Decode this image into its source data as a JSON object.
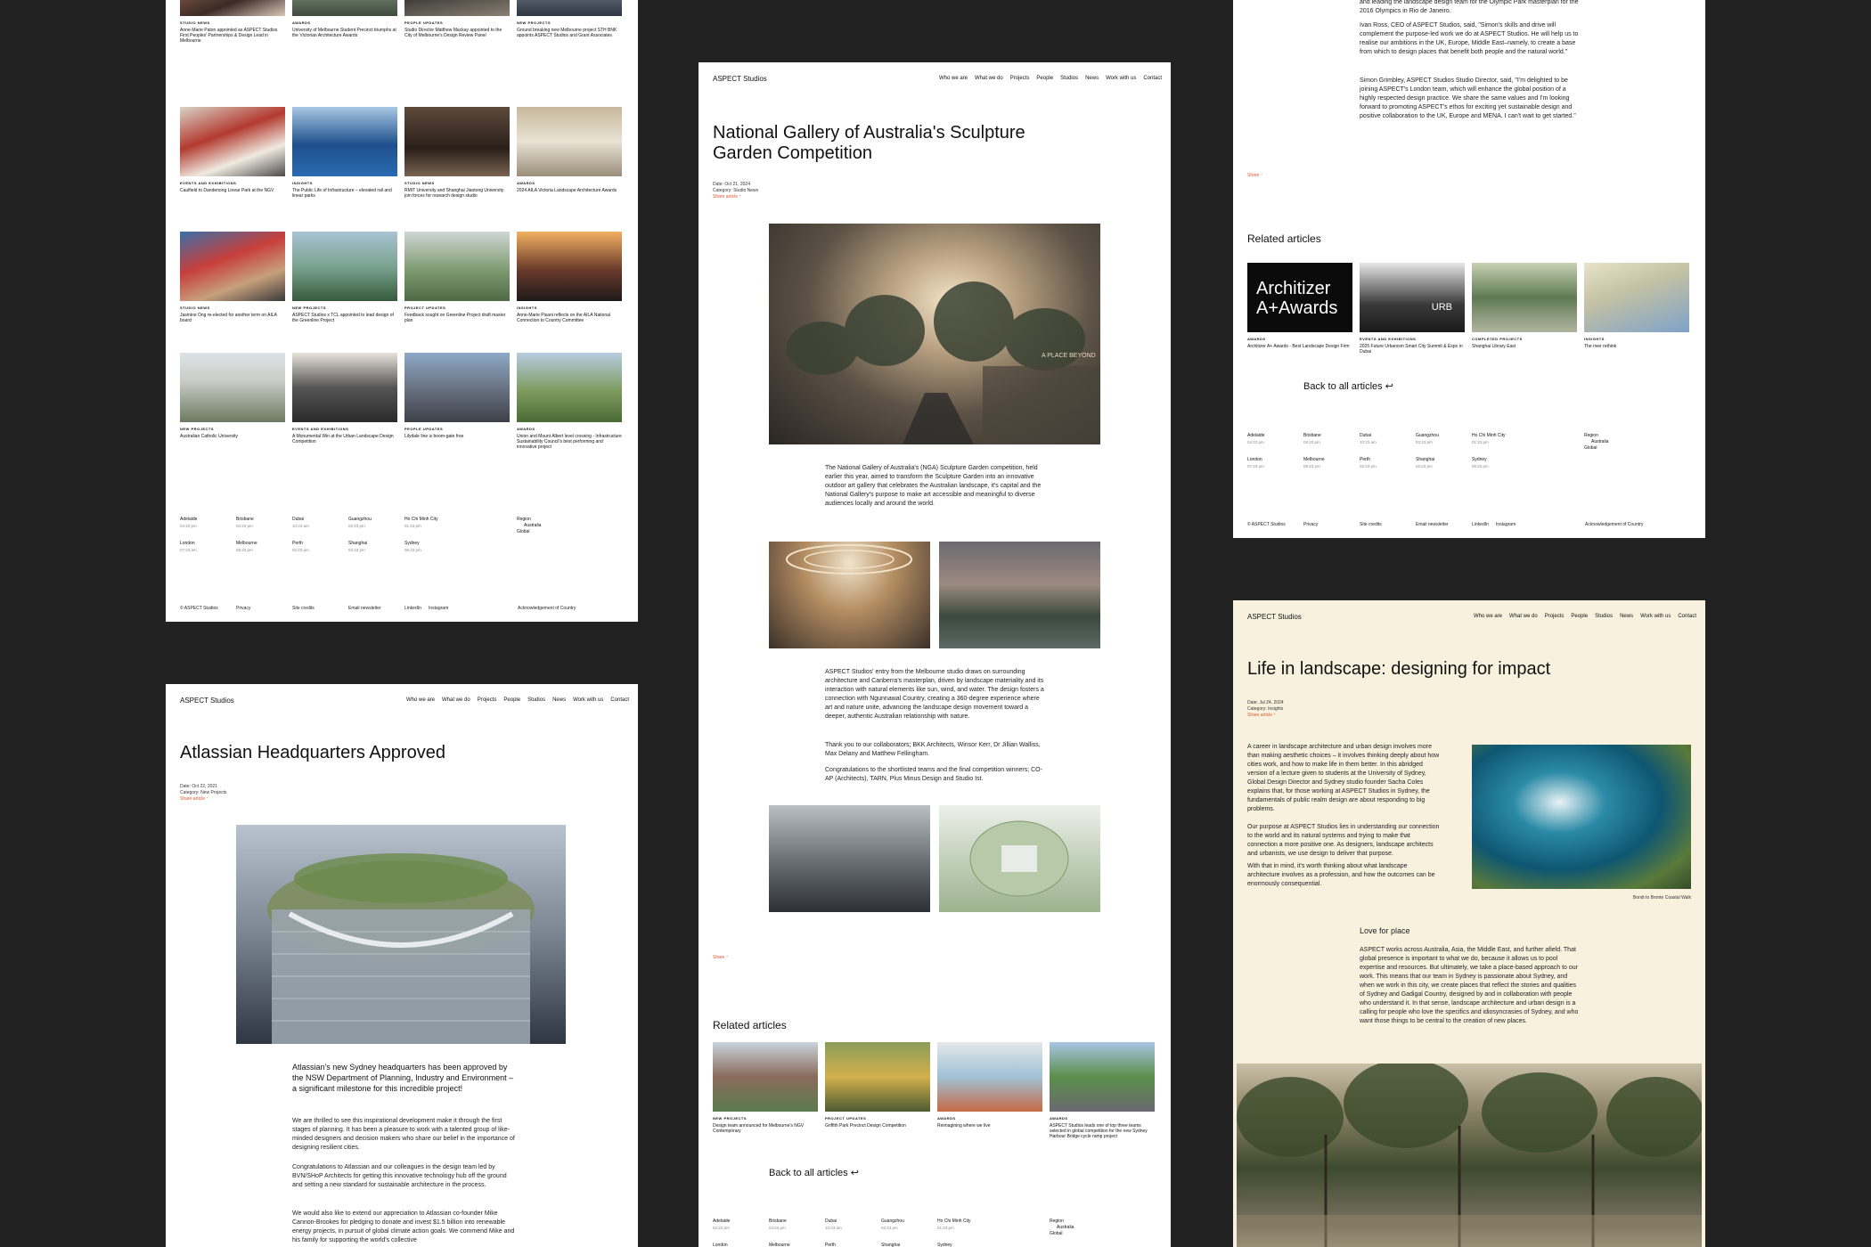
{
  "site": {
    "logo": "ASPECT Studios",
    "nav": [
      "Who we are",
      "What we do",
      "Projects",
      "People",
      "Studios",
      "News",
      "Work with us",
      "Contact"
    ]
  },
  "grid_panel": {
    "tiles": [
      {
        "cat": "Studio News",
        "title": "Anne-Marie Paton appointed as ASPECT Studios First Peoples' Partnerships & Design Lead in Melbourne"
      },
      {
        "cat": "Awards",
        "title": "University of Melbourne Student Precinct triumphs at the Victorian Architecture Awards"
      },
      {
        "cat": "People Updates",
        "title": "Studio Director Matthew Mackay appointed to the City of Melbourne's Design Review Panel"
      },
      {
        "cat": "New Projects",
        "title": "Ground breaking new Melbourne project STH BNK appoints ASPECT Studios and Grant Associates"
      },
      {
        "cat": "Events and Exhibitions",
        "title": "Caulfield to Dandenong Linear Park at the NGV"
      },
      {
        "cat": "Insights",
        "title": "The Public Life of Infrastructure – elevated rail and linear parks"
      },
      {
        "cat": "Studio News",
        "title": "RMIT University and Shanghai Jiaotong University join forces for research design studio"
      },
      {
        "cat": "Awards",
        "title": "2024 AILA Victoria Landscape Architecture Awards"
      },
      {
        "cat": "Studio News",
        "title": "Jasmine Ong re-elected for another term on AILA board"
      },
      {
        "cat": "New Projects",
        "title": "ASPECT Studios x TCL appointed to lead design of the Greenline Project"
      },
      {
        "cat": "Project Updates",
        "title": "Feedback sought on Greenline Project draft master plan"
      },
      {
        "cat": "Insights",
        "title": "Anne-Marie Pisani reflects on the AILA National Connection to Country Committee"
      },
      {
        "cat": "New Projects",
        "title": "Australian Catholic University"
      },
      {
        "cat": "Events and Exhibitions",
        "title": "A Monumental Win at the Urban Landscape Design Competition"
      },
      {
        "cat": "People Updates",
        "title": "Lilydale line is boom-gate free"
      },
      {
        "cat": "Awards",
        "title": "Union and Mount Albert level crossing - Infrastructure Sustainability Council's best performing and innovative project"
      }
    ]
  },
  "cities": {
    "row1": [
      {
        "name": "Adelaide",
        "time": "04:22 pm"
      },
      {
        "name": "Brisbane",
        "time": "04:23 pm"
      },
      {
        "name": "Dubai",
        "time": "10:23 am"
      },
      {
        "name": "Guangzhou",
        "time": "02:23 pm"
      },
      {
        "name": "Ho Chi Minh City",
        "time": "01:23 pm"
      }
    ],
    "row2": [
      {
        "name": "London",
        "time": "07:23 am"
      },
      {
        "name": "Melbourne",
        "time": "06:23 pm"
      },
      {
        "name": "Perth",
        "time": "02:23 pm"
      },
      {
        "name": "Shanghai",
        "time": "02:23 pm"
      },
      {
        "name": "Sydney",
        "time": "06:23 pm"
      }
    ],
    "region_label": "Region",
    "region_value": "Australia",
    "region_global": "Global"
  },
  "footer": [
    "© ASPECT Studios",
    "Privacy",
    "Site credits",
    "Email newsletter",
    "LinkedIn",
    "Instagram",
    "Acknowledgement of Country"
  ],
  "atlassian": {
    "title": "Atlassian Headquarters Approved",
    "date": "Date: Oct 22, 2021",
    "category": "Category: New Projects",
    "share": "Share article ⁺",
    "lead": "Atlassian's new Sydney headquarters has been approved by the NSW Department of Planning, Industry and Environment – a significant milestone for this incredible project!",
    "p1": "We are thrilled to see this inspirational development make it through the first stages of planning. It has been a pleasure to work with a talented group of like-minded designers and decision makers who share our belief in the importance of designing resilient cities.",
    "p2": "Congratulations to Atlassian and our colleagues in the design team led by BVN/SHoP Architects for getting this innovative technology hub off the ground and setting a new standard for sustainable architecture in the process.",
    "p3": "We would also like to extend our appreciation to Atlassian co-founder Mike Cannon-Brookes for pledging to donate and invest $1.5 billion into renewable energy projects, in pursuit of global climate action goals. We commend Mike and his family for supporting the world's collective"
  },
  "nga": {
    "title": "National Gallery of Australia's Sculpture Garden Competition",
    "date": "Date: Oct 21, 2024",
    "category": "Category: Studio News",
    "share": "Share article ⁺",
    "hero_sign": "A PLACE BEYOND",
    "p1": "The National Gallery of Australia's (NGA) Sculpture Garden competition, held earlier this year, aimed to transform the Sculpture Garden into an innovative outdoor art gallery that celebrates the Australian landscape, it's capital and the National Gallery's purpose to make art accessible and meaningful to diverse audiences locally and around the world.",
    "p2": "ASPECT Studios' entry from the Melbourne studio draws on surrounding architecture and Canberra's masterplan, driven by landscape materiality and its interaction with natural elements like sun, wind, and water. The design fosters a connection with Ngunnawal Country, creating a 360-degree experience where art and nature unite, advancing the landscape design movement toward a deeper, authentic Australian relationship with nature.",
    "p3": "Thank you to our collaborators; BKK Architects, Winsor Kerr, Dr Jillian Walliss, Max Delany and Matthew Fellingham.",
    "p4": "Congratulations to the shortlisted teams and the final competition winners; CO-AP (Architects), TARN, Plus Minus Design and Studio Ist.",
    "share2": "Share ⁺",
    "related_title": "Related articles",
    "related": [
      {
        "cat": "New Projects",
        "title": "Design team announced for Melbourne's NGV Contemporary"
      },
      {
        "cat": "Project Updates",
        "title": "Griffith Park Precinct Design Competition"
      },
      {
        "cat": "Awards",
        "title": "Reimagining where we live"
      },
      {
        "cat": "Awards",
        "title": "ASPECT Studios leads one of top three teams selected in global competition for the new Sydney Harbour Bridge cycle ramp project"
      }
    ],
    "back": "Back to all articles ↩"
  },
  "top_right": {
    "p1": "and leading the landscape design team for the Olympic Park masterplan for the 2016 Olympics in Rio de Janeiro.",
    "p2": "Ivan Ross, CEO of ASPECT Studios, said, \"Simon's skills and drive will complement the purpose-led work we do at ASPECT Studios. He will help us to realise our ambitions in the UK, Europe, Middle East–namely, to create a base from which to design places that benefit both people and the natural world.\"",
    "p3": "Simon Grimbley, ASPECT Studios Studio Director, said, \"I'm delighted to be joining ASPECT's London team, which will enhance the global position of a highly respected design practice. We share the same values and I'm looking forward to promoting ASPECT's ethos for exciting yet sustainable design and positive collaboration to the UK, Europe and MENA. I can't wait to get started.\"",
    "share": "Share ⁺",
    "related_title": "Related articles",
    "award_line1": "Architizer",
    "award_line2": "A+Awards",
    "screen_text": "URB",
    "related": [
      {
        "cat": "Awards",
        "title": "Architizer A+ Awards - Best Landscape Design Firm"
      },
      {
        "cat": "Events and Exhibitions",
        "title": "2025 Future Urbanism Smart City Summit & Expo in Dubai"
      },
      {
        "cat": "Completed Projects",
        "title": "Shanghai Library East"
      },
      {
        "cat": "Insights",
        "title": "The river rethink"
      }
    ],
    "back": "Back to all articles ↩"
  },
  "landscape": {
    "title": "Life in landscape: designing for impact",
    "date": "Date: Jul 24, 2024",
    "category": "Category: Insights",
    "share": "Share article ⁺",
    "p1": "A career in landscape architecture and urban design involves more than making aesthetic choices – it involves thinking deeply about how cities work, and how to make life in them better. In this abridged version of a lecture given to students at the University of Sydney, Global Design Director and Sydney studio founder Sacha Coles explains that, for those working at ASPECT Studios in Sydney, the fundamentals of public realm design are about responding to big problems.",
    "p2": "Our purpose at ASPECT Studios lies in understanding our connection to the world and its natural systems and trying to make that connection a more positive one. As designers, landscape architects and urbanists, we use design to deliver that purpose.",
    "p3": "With that in mind, it's worth thinking about what landscape architecture involves as a profession, and how the outcomes can be enormously consequential.",
    "caption": "Bondi to Bronte Coastal Walk",
    "subhead": "Love for place",
    "p4": "ASPECT works across Australia, Asia, the Middle East, and further afield. That global presence is important to what we do, because it allows us to pool expertise and resources. But ultimately, we take a place-based approach to our work. This means that our team in Sydney is passionate about Sydney, and when we work in this city, we create places that reflect the stories and qualities of Sydney and Gadigal Country, designed by and in collaboration with people who understand it. In that sense, landscape architecture and urban design is a calling for people who love the specifics and idiosyncrasies of Sydney, and who want those things to be central to the creation of new places."
  }
}
